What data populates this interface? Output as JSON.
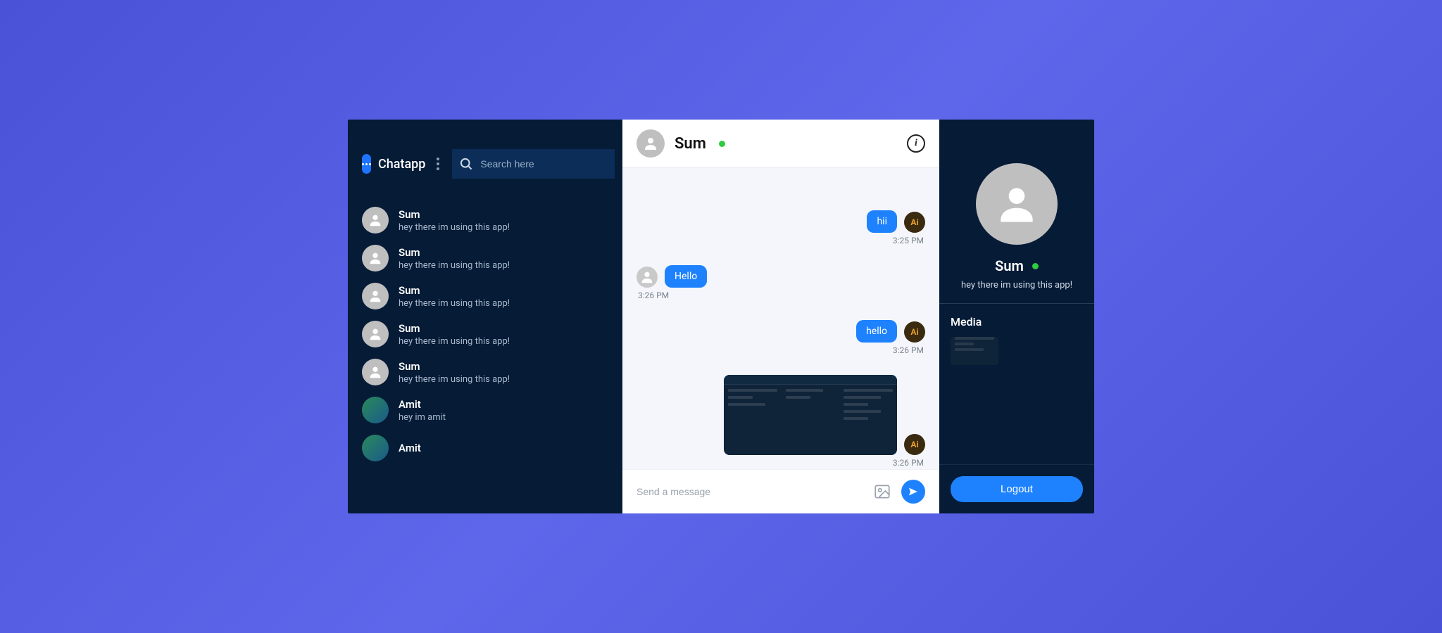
{
  "app": {
    "name": "Chatapp"
  },
  "search": {
    "placeholder": "Search here"
  },
  "contacts": [
    {
      "name": "Sum",
      "preview": "hey there im using this app!",
      "avatar": "default"
    },
    {
      "name": "Sum",
      "preview": "hey there im using this app!",
      "avatar": "default"
    },
    {
      "name": "Sum",
      "preview": "hey there im using this app!",
      "avatar": "default"
    },
    {
      "name": "Sum",
      "preview": "hey there im using this app!",
      "avatar": "default"
    },
    {
      "name": "Sum",
      "preview": "hey there im using this app!",
      "avatar": "default"
    },
    {
      "name": "Amit",
      "preview": "hey im amit",
      "avatar": "colored"
    },
    {
      "name": "Amit",
      "preview": "",
      "avatar": "colored"
    }
  ],
  "chat": {
    "peer": "Sum",
    "online": true,
    "messages": [
      {
        "side": "right",
        "type": "text",
        "text": "hii",
        "time": "3:25 PM",
        "avatar": "ai"
      },
      {
        "side": "left",
        "type": "text",
        "text": "Hello",
        "time": "3:26 PM",
        "avatar": "default"
      },
      {
        "side": "right",
        "type": "text",
        "text": "hello",
        "time": "3:26 PM",
        "avatar": "ai"
      },
      {
        "side": "right",
        "type": "image",
        "text": "",
        "time": "3:26 PM",
        "avatar": "ai"
      }
    ],
    "input_placeholder": "Send a message"
  },
  "profile": {
    "name": "Sum",
    "online": true,
    "status_text": "hey there im using this app!",
    "media_heading": "Media",
    "logout_label": "Logout"
  }
}
